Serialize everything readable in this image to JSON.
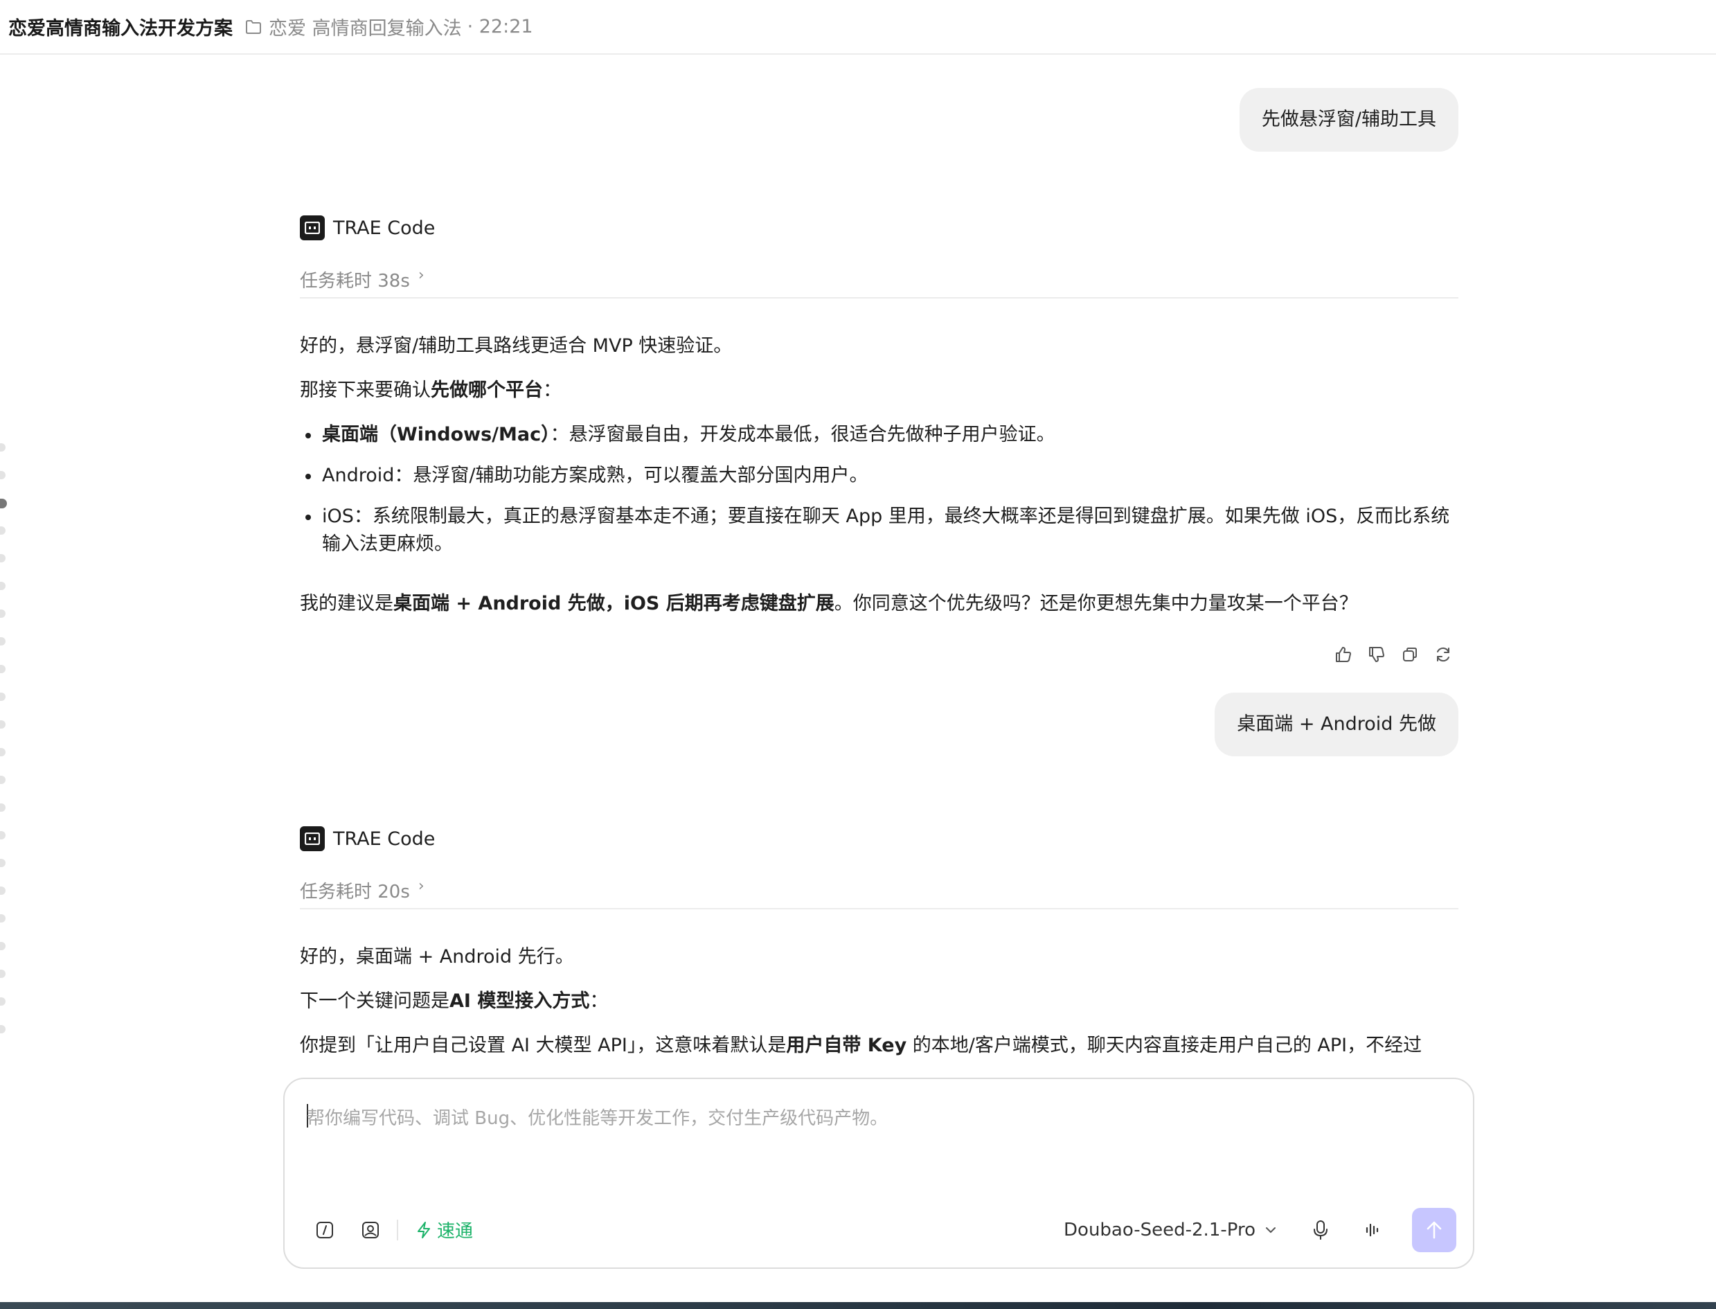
{
  "header": {
    "title": "恋爱高情商输入法开发方案",
    "breadcrumb": "恋爱 高情商回复输入法",
    "time": "· 22:21"
  },
  "messages": {
    "user1": "先做悬浮窗/辅助工具",
    "assistant1": {
      "name": "TRAE Code",
      "task_time": "任务耗时 38s",
      "p1": "好的，悬浮窗/辅助工具路线更适合 MVP 快速验证。",
      "p2_prefix": "那接下来要确认",
      "p2_bold": "先做哪个平台",
      "p2_suffix": "：",
      "bullets": [
        {
          "bold": "桌面端（Windows/Mac）",
          "text": "：悬浮窗最自由，开发成本最低，很适合先做种子用户验证。"
        },
        {
          "bold": "",
          "text": "Android：悬浮窗/辅助功能方案成熟，可以覆盖大部分国内用户。"
        },
        {
          "bold": "",
          "text": "iOS：系统限制最大，真正的悬浮窗基本走不通；要直接在聊天 App 里用，最终大概率还是得回到键盘扩展。如果先做 iOS，反而比系统输入法更麻烦。"
        }
      ],
      "p3_prefix": "我的建议是",
      "p3_bold": "桌面端 + Android 先做，iOS 后期再考虑键盘扩展",
      "p3_suffix": "。你同意这个优先级吗？还是你更想先集中力量攻某一个平台？"
    },
    "user2": "桌面端 + Android 先做",
    "assistant2": {
      "name": "TRAE Code",
      "task_time": "任务耗时 20s",
      "p1": "好的，桌面端 + Android 先行。",
      "p2_prefix": "下一个关键问题是",
      "p2_bold": "AI 模型接入方式",
      "p2_suffix": "：",
      "p3_prefix": "你提到「让用户自己设置 AI 大模型 API」，这意味着默认是",
      "p3_bold": "用户自带 Key",
      "p3_suffix": " 的本地/客户端模式，聊天内容直接走用户自己的 API，不经过"
    }
  },
  "composer": {
    "placeholder": "帮你编写代码、调试 Bug、优化性能等开发工作，交付生产级代码产物。",
    "speed_label": "速通",
    "model": "Doubao-Seed-2.1-Pro"
  },
  "icons": {
    "folder": "folder-icon",
    "logo": "trae-logo-icon",
    "like": "thumbs-up-icon",
    "dislike": "thumbs-down-icon",
    "copy": "copy-icon",
    "regenerate": "refresh-icon",
    "slash": "slash-command-icon",
    "image": "image-upload-icon",
    "bolt": "lightning-icon",
    "mic": "microphone-icon",
    "voice": "voice-wave-icon",
    "send": "send-arrow-icon"
  },
  "colors": {
    "accent_green": "#1db36a",
    "send_button": "#c7c6ff",
    "bubble_bg": "#f0f0f0"
  }
}
